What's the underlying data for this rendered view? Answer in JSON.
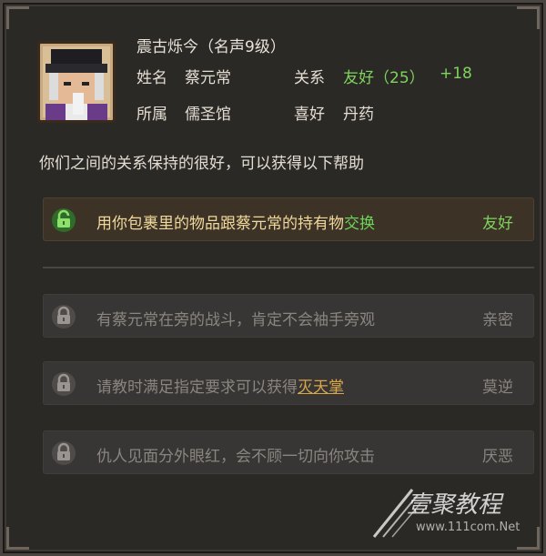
{
  "header": {
    "title": "震古烁今（名声9级）",
    "name_label": "姓名",
    "name_value": "蔡元常",
    "relation_label": "关系",
    "relation_value": "友好（25）",
    "relation_delta": "+18",
    "faction_label": "所属",
    "faction_value": "儒圣馆",
    "hobby_label": "喜好",
    "hobby_value": "丹药"
  },
  "description": "你们之间的关系保持的很好，可以获得以下帮助",
  "benefits": [
    {
      "text_before": "用你包裹里的物品跟蔡元常的持有物",
      "highlight": "交换",
      "text_after": "",
      "tier": "友好",
      "state": "unlocked"
    },
    {
      "text_before": "有蔡元常在旁的战斗，肯定不会袖手旁观",
      "highlight": "",
      "text_after": "",
      "tier": "亲密",
      "state": "locked"
    },
    {
      "text_before": "请教时满足指定要求可以获得",
      "highlight": "灭天掌",
      "text_after": "",
      "tier": "莫逆",
      "state": "locked"
    },
    {
      "text_before": "仇人见面分外眼红，会不顾一切向你攻击",
      "highlight": "",
      "text_after": "",
      "tier": "厌恶",
      "state": "locked"
    }
  ],
  "watermark": {
    "brand": "壹聚教程",
    "url": "www.111com.Net"
  },
  "colors": {
    "unlock_green": "#7fd35d",
    "lock_gray": "#8a8580",
    "highlight_gold": "#d8a64a"
  },
  "icons": {
    "unlocked": "lock-open-icon",
    "locked": "lock-icon"
  }
}
